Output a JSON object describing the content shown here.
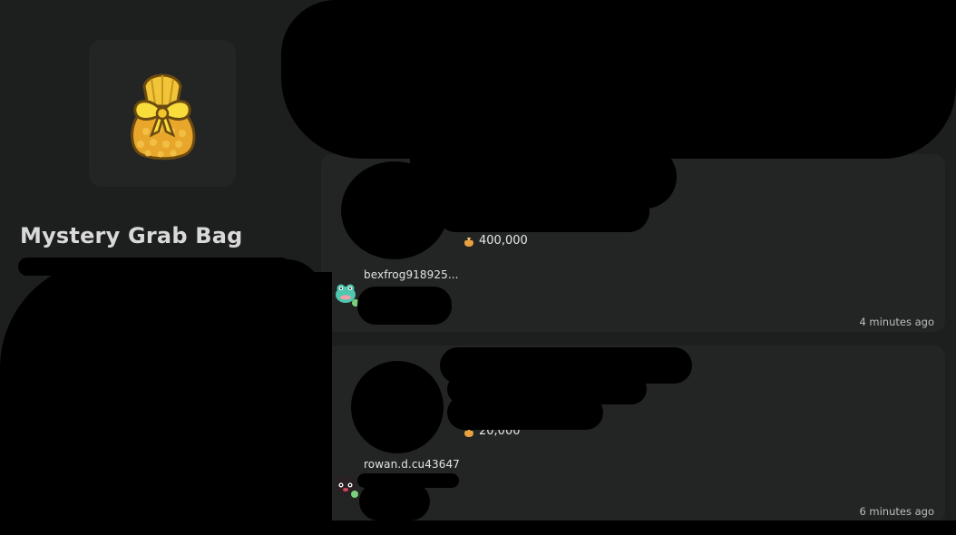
{
  "item": {
    "title": "Mystery Grab Bag",
    "icon": "mystery-grab-bag-icon"
  },
  "listings": [
    {
      "price": "400,000",
      "currency_icon": "bells-bag-icon",
      "seller": "bexfrog918925...",
      "seller_avatar": "frog-avatar-icon",
      "time": "4 minutes ago"
    },
    {
      "price": "20,000",
      "currency_icon": "bells-bag-icon",
      "seller": "rowan.d.cu43647",
      "seller_avatar": "cat-avatar-icon",
      "time": "6 minutes ago"
    }
  ],
  "colors": {
    "background": "#1d1e1e",
    "card": "#232424",
    "bag_gold": "#e8b32e",
    "ribbon": "#f5d63a"
  }
}
